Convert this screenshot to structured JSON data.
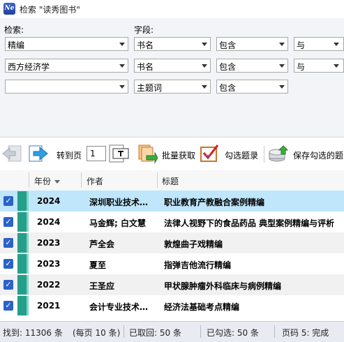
{
  "window": {
    "app_icon_text": "Ne",
    "title": "检索 \"读秀图书\""
  },
  "search": {
    "label_search": "检索:",
    "label_field": "字段:",
    "rows": [
      {
        "term": "精编",
        "field": "书名",
        "match": "包含",
        "logic": "与"
      },
      {
        "term": "西方经济学",
        "field": "书名",
        "match": "包含",
        "logic": "与"
      },
      {
        "term": "",
        "field": "主题词",
        "match": "包含",
        "logic": ""
      }
    ]
  },
  "toolbar": {
    "goto_label": "转到页",
    "page_value": "1",
    "batch_label": "批量获取",
    "check_label": "勾选题录",
    "save_label": "保存勾选的题"
  },
  "table": {
    "columns": [
      "年份",
      "作者",
      "标题"
    ],
    "rows": [
      {
        "year": "2024",
        "author": "深圳职业技术…",
        "title": "职业教育产教融合案例精编",
        "selected": true
      },
      {
        "year": "2024",
        "author": "马金辉; 白文慧",
        "title": "法律人视野下的食品药品  典型案例精编与评析",
        "selected": false
      },
      {
        "year": "2023",
        "author": "芦全会",
        "title": "敦煌曲子戏精编",
        "selected": false
      },
      {
        "year": "2023",
        "author": "夏至",
        "title": "指弹吉他流行精编",
        "selected": false
      },
      {
        "year": "2022",
        "author": "王圣应",
        "title": "甲状腺肿瘤外科临床与病例精编",
        "selected": false
      },
      {
        "year": "2021",
        "author": "会计专业技术…",
        "title": "经济法基础考点精编",
        "selected": false
      }
    ]
  },
  "status": {
    "found": "找到: 11306 条",
    "per_page": "(每页 10 条)",
    "retrieved": "已取回: 50 条",
    "checked": "已勾选: 50 条",
    "page_status": "页码 5: 完成"
  },
  "colors": {
    "selected_row": "#bfe6fb",
    "even_row": "#f1f1f1",
    "checkbox": "#2a62c9",
    "book": "#24a08a"
  }
}
